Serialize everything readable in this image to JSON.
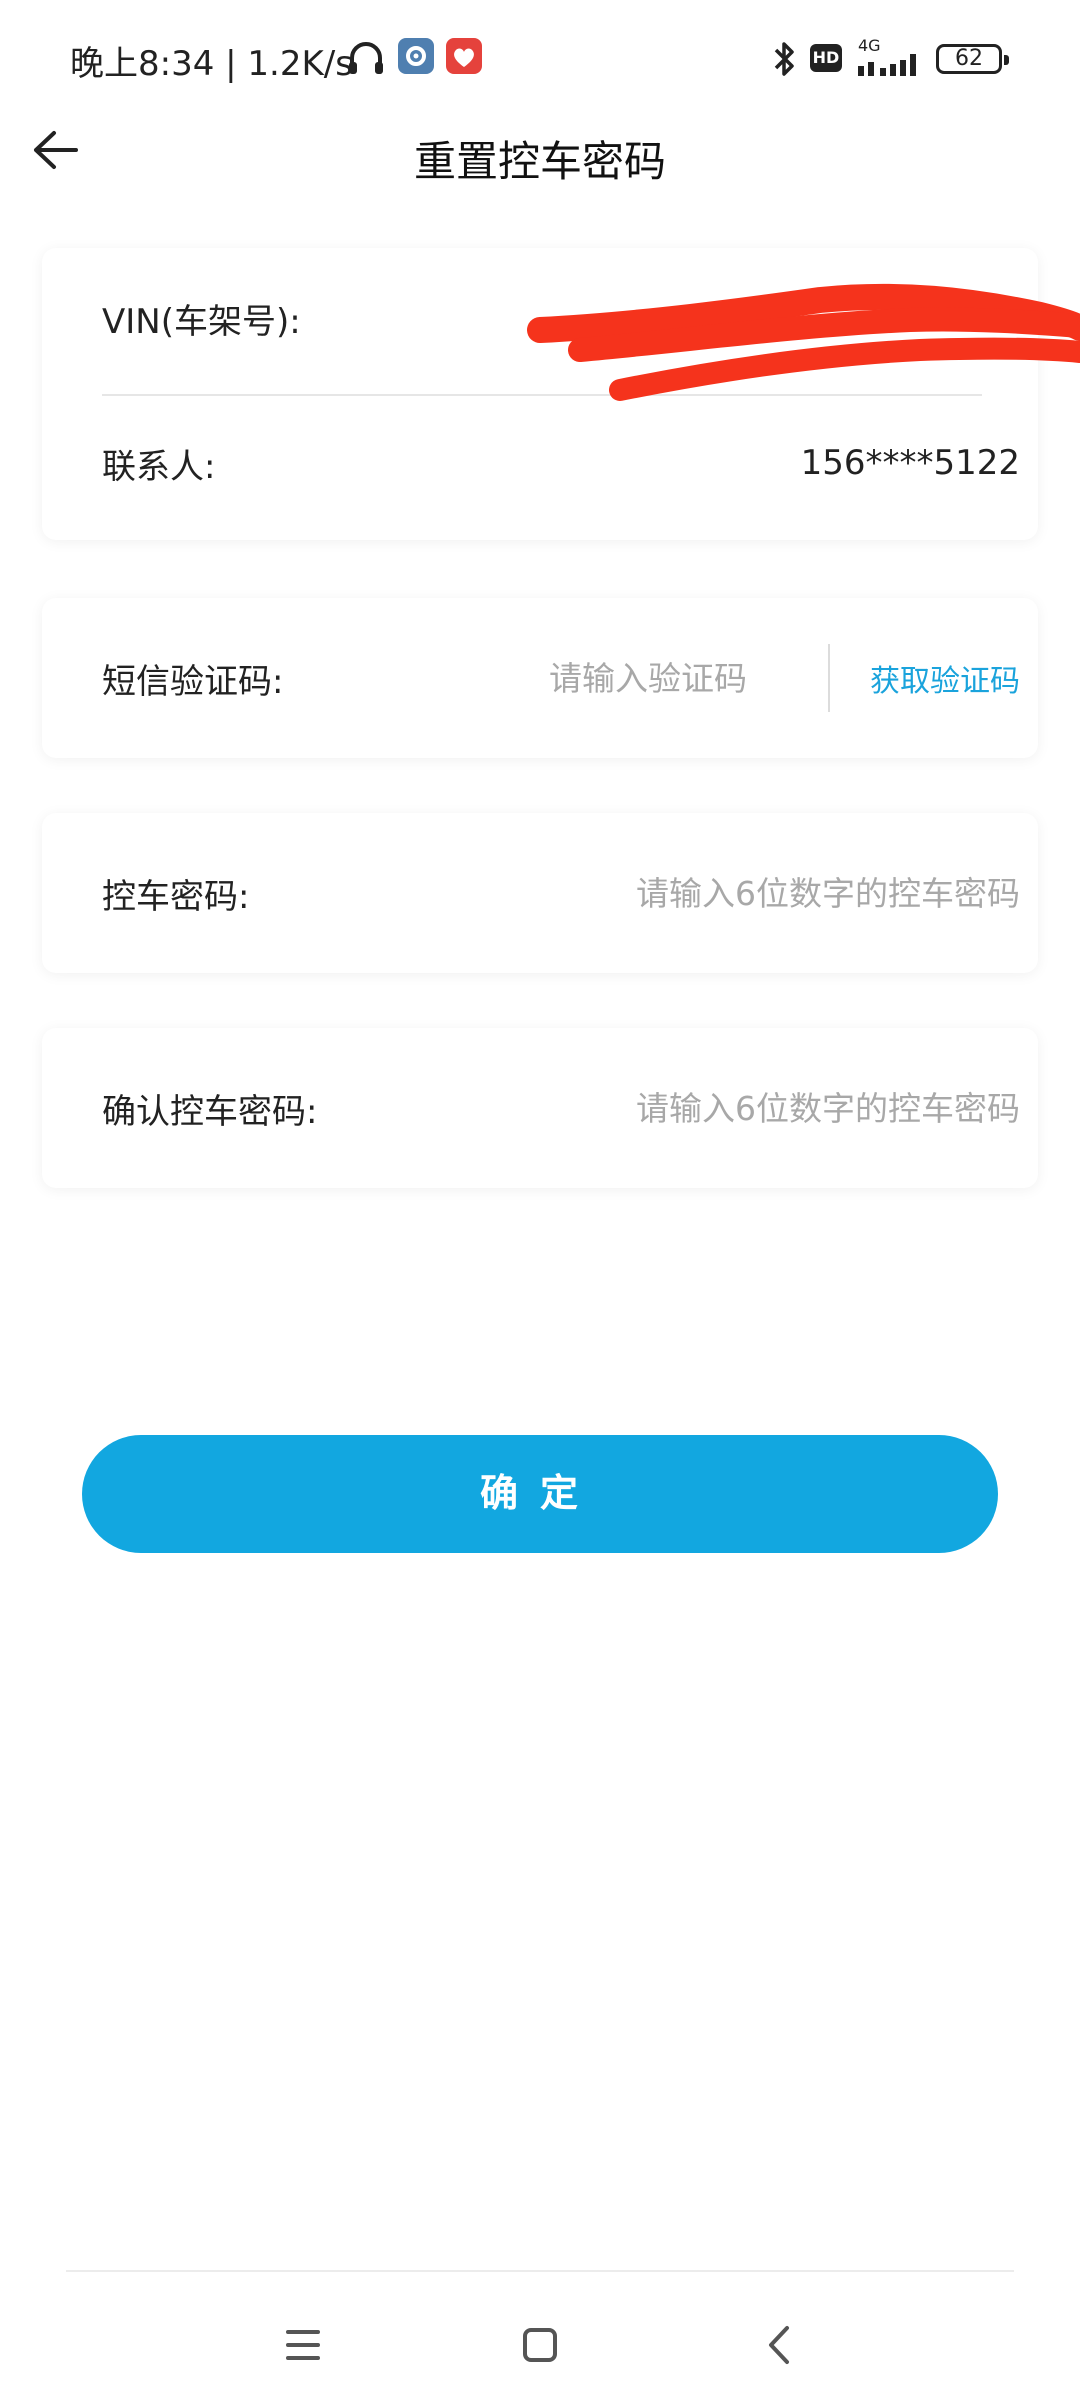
{
  "status_bar": {
    "time": "晚上8:34 | 1.2K/s",
    "network_label": "4G",
    "hd_label": "HD",
    "battery": "62",
    "icons": [
      "headphones-icon",
      "settings-app-icon",
      "red-app-icon",
      "bluetooth-icon",
      "signal-icon",
      "battery-icon"
    ]
  },
  "header": {
    "title": "重置控车密码",
    "back_icon": "arrow-left-icon"
  },
  "vehicle_info": {
    "vin_label": "VIN(车架号):",
    "contact_label": "联系人:",
    "contact_value": "156****5122"
  },
  "sms": {
    "label": "短信验证码:",
    "placeholder": "请输入验证码",
    "get_code_label": "获取验证码"
  },
  "password": {
    "label": "控车密码:",
    "placeholder": "请输入6位数字的控车密码"
  },
  "confirm_password": {
    "label": "确认控车密码:",
    "placeholder": "请输入6位数字的控车密码"
  },
  "confirm_button": {
    "label": "确定"
  },
  "colors": {
    "accent": "#12a7e0",
    "link": "#1aa3dc",
    "scribble": "#f5331c"
  },
  "nav_bar": {
    "icons": [
      "menu-icon",
      "home-icon",
      "back-icon"
    ]
  }
}
